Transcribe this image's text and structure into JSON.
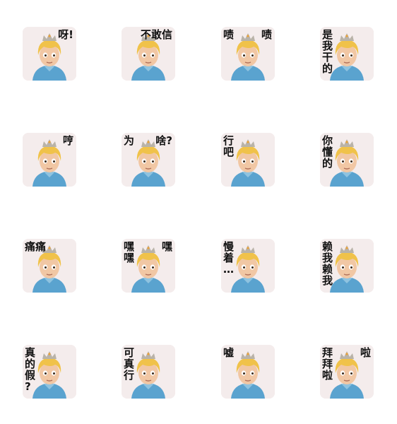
{
  "stickers": [
    {
      "id": "s1",
      "texts": [
        {
          "t": "呀!",
          "pos": "tr"
        }
      ]
    },
    {
      "id": "s2",
      "texts": [
        {
          "t": "不敢信",
          "pos": "tr"
        }
      ]
    },
    {
      "id": "s3",
      "texts": [
        {
          "t": "啧",
          "pos": "tl"
        },
        {
          "t": "啧",
          "pos": "tr"
        }
      ]
    },
    {
      "id": "s4",
      "texts": [
        {
          "t": "是\n我\n干\n的",
          "pos": "lcol"
        }
      ]
    },
    {
      "id": "s5",
      "texts": [
        {
          "t": "哼",
          "pos": "tr"
        }
      ]
    },
    {
      "id": "s6",
      "texts": [
        {
          "t": "为",
          "pos": "tl"
        },
        {
          "t": "啥?",
          "pos": "tr"
        }
      ]
    },
    {
      "id": "s7",
      "texts": [
        {
          "t": "行\n吧",
          "pos": "lcol"
        }
      ]
    },
    {
      "id": "s8",
      "texts": [
        {
          "t": "你\n懂\n的",
          "pos": "lcol"
        }
      ]
    },
    {
      "id": "s9",
      "texts": [
        {
          "t": "痛痛",
          "pos": "tl"
        }
      ]
    },
    {
      "id": "s10",
      "texts": [
        {
          "t": "嘿\n嘿",
          "pos": "lcol"
        },
        {
          "t": "嘿",
          "pos": "tr"
        }
      ]
    },
    {
      "id": "s11",
      "texts": [
        {
          "t": "慢\n着\n…",
          "pos": "lcol"
        }
      ]
    },
    {
      "id": "s12",
      "texts": [
        {
          "t": "赖\n我\n赖\n我",
          "pos": "lcol"
        }
      ]
    },
    {
      "id": "s13",
      "texts": [
        {
          "t": "真\n的\n假\n?",
          "pos": "lcol"
        }
      ]
    },
    {
      "id": "s14",
      "texts": [
        {
          "t": "可\n真\n行",
          "pos": "lcol"
        }
      ]
    },
    {
      "id": "s15",
      "texts": [
        {
          "t": "嘘",
          "pos": "tl"
        }
      ]
    },
    {
      "id": "s16",
      "texts": [
        {
          "t": "拜\n拜\n啦",
          "pos": "lcol"
        },
        {
          "t": "啦",
          "pos": "tr"
        }
      ]
    }
  ],
  "colors": {
    "tile_bg": "#f4ecec",
    "hair": "#f0c24a",
    "skin": "#f1c7a4",
    "robe": "#5aa3cf",
    "crown": "#b9b3a8",
    "text": "#111111"
  },
  "character_icon": "prince-character-icon"
}
